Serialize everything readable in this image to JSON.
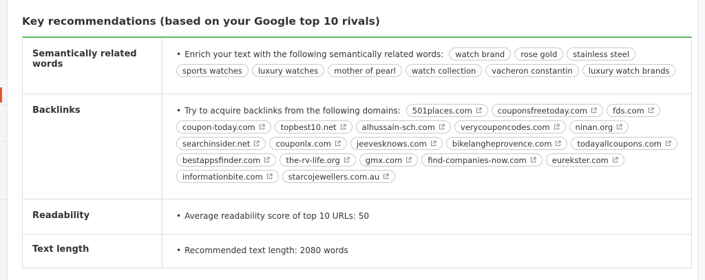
{
  "panel": {
    "title": "Key recommendations (based on your Google top 10 rivals)"
  },
  "rows": {
    "semantic": {
      "label": "Semantically related words",
      "text": "Enrich your text with the following semantically related words:",
      "chips": [
        "watch brand",
        "rose gold",
        "stainless steel",
        "sports watches",
        "luxury watches",
        "mother of pearl",
        "watch collection",
        "vacheron constantin",
        "luxury watch brands"
      ]
    },
    "backlinks": {
      "label": "Backlinks",
      "text": "Try to acquire backlinks from the following domains:",
      "chips": [
        "501places.com",
        "couponsfreetoday.com",
        "fds.com",
        "coupon-today.com",
        "topbest10.net",
        "alhussain-sch.com",
        "verycouponcodes.com",
        "ninan.org",
        "searchinsider.net",
        "couponlx.com",
        "jeevesknows.com",
        "bikelangheprovence.com",
        "todayallcoupons.com",
        "bestappsfinder.com",
        "the-rv-life.org",
        "gmx.com",
        "find-companies-now.com",
        "eurekster.com",
        "informationbite.com",
        "starcojewellers.com.au"
      ],
      "icon": "external-link-icon"
    },
    "readability": {
      "label": "Readability",
      "text": "Average readability score of top 10 URLs:",
      "value": "50"
    },
    "text_length": {
      "label": "Text length",
      "text": "Recommended text length:",
      "value": "2080 words"
    }
  },
  "colors": {
    "accent_border": "#5cb85c",
    "side_marker": "#e4572e"
  }
}
